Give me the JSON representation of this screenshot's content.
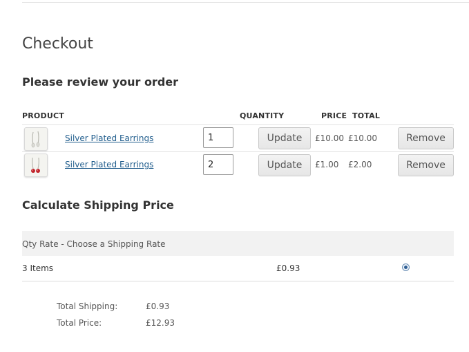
{
  "page": {
    "title": "Checkout"
  },
  "review": {
    "heading": "Please review your order",
    "columns": {
      "product": "PRODUCT",
      "quantity": "QUANTITY",
      "price": "PRICE",
      "total": "TOTAL"
    },
    "items": [
      {
        "name": "Silver Plated Earrings",
        "quantity": "1",
        "price": "£10.00",
        "total": "£10.00",
        "update_label": "Update",
        "remove_label": "Remove",
        "thumb_icon": "earrings-thumbnail"
      },
      {
        "name": "Silver Plated Earrings",
        "quantity": "2",
        "price": "£1.00",
        "total": "£2.00",
        "update_label": "Update",
        "remove_label": "Remove",
        "thumb_icon": "red-earrings-thumbnail"
      }
    ]
  },
  "shipping": {
    "heading": "Calculate Shipping Price",
    "method_label": "Qty Rate - Choose a Shipping Rate",
    "option": {
      "label": "3 Items",
      "amount": "£0.93",
      "selected": true
    }
  },
  "summary": {
    "shipping_label": "Total Shipping:",
    "shipping_value": "£0.93",
    "price_label": "Total Price:",
    "price_value": "£12.93"
  },
  "colors": {
    "link": "#1f5c8c",
    "radio_selected": "#2f5f95"
  }
}
